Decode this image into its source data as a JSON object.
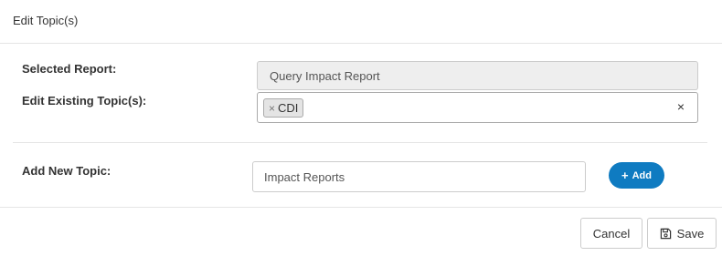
{
  "dialog": {
    "title": "Edit Topic(s)"
  },
  "selected_report": {
    "label": "Selected Report:",
    "value": "Query Impact Report"
  },
  "existing_topics": {
    "label": "Edit Existing Topic(s):",
    "tags": [
      {
        "remove_glyph": "×",
        "text": "CDI"
      }
    ],
    "clear_glyph": "×"
  },
  "new_topic": {
    "label": "Add New Topic:",
    "value": "Impact Reports",
    "add_button": {
      "icon": "plus-icon",
      "label": "Add",
      "color": "#0f7bc1"
    }
  },
  "footer": {
    "cancel_label": "Cancel",
    "save_label": "Save",
    "save_icon": "floppy-disk-icon"
  }
}
